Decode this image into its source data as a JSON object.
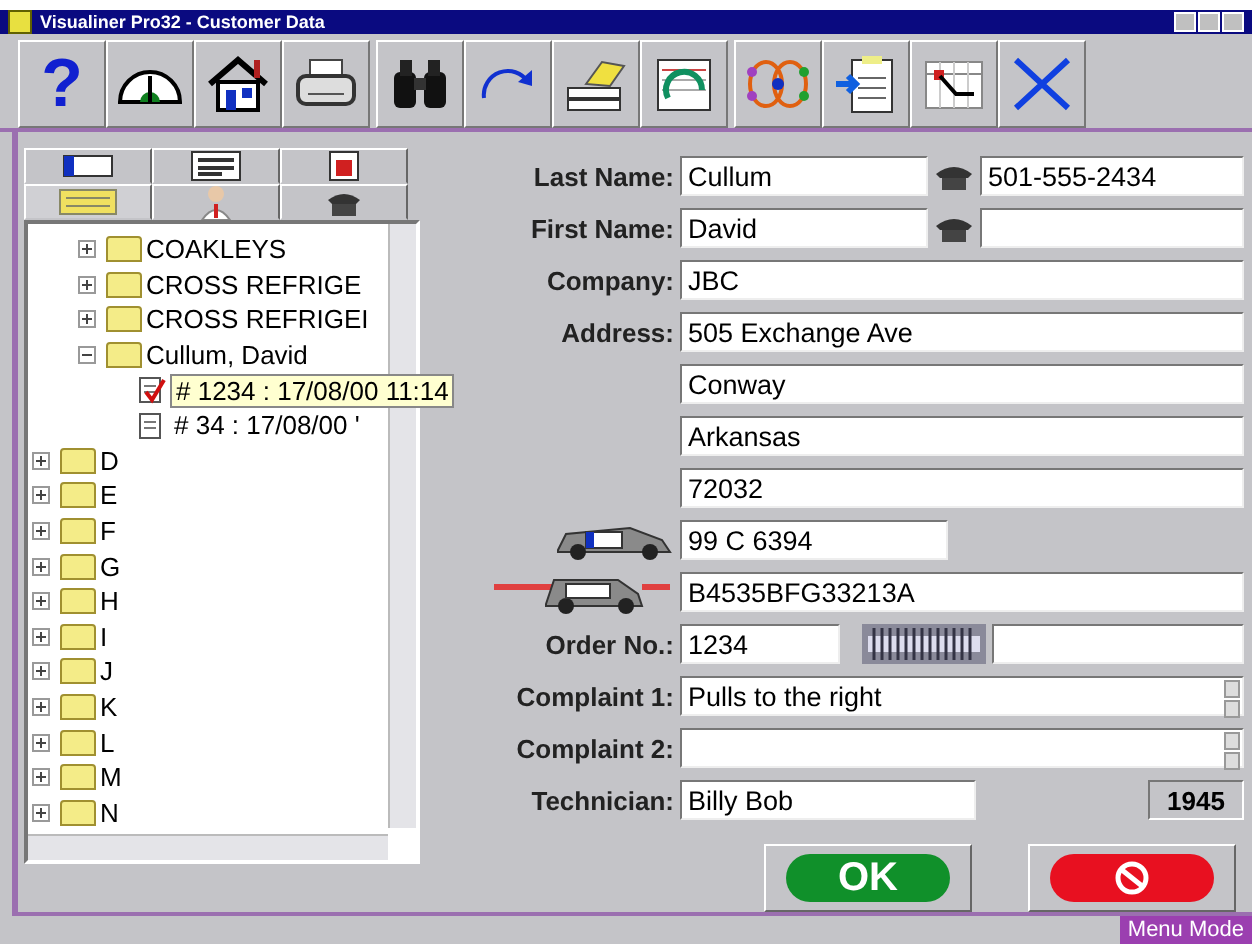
{
  "window": {
    "title": "Visualiner Pro32 - Customer Data"
  },
  "toolbar": [
    [
      {
        "kind": "help",
        "label": "?"
      },
      {
        "kind": "gauge"
      },
      {
        "kind": "home"
      },
      {
        "kind": "printer"
      }
    ],
    [
      {
        "kind": "binoculars"
      },
      {
        "kind": "redo"
      },
      {
        "kind": "eraser"
      },
      {
        "kind": "graph"
      }
    ],
    [
      {
        "kind": "network"
      },
      {
        "kind": "clipboard"
      },
      {
        "kind": "calendar"
      },
      {
        "kind": "close"
      }
    ]
  ],
  "side_tabs": [
    {
      "kind": "plate",
      "selected": false
    },
    {
      "kind": "list",
      "selected": false
    },
    {
      "kind": "calendar",
      "selected": false
    },
    {
      "kind": "card",
      "selected": true
    },
    {
      "kind": "person",
      "selected": false
    },
    {
      "kind": "phone",
      "selected": false
    }
  ],
  "tree": {
    "nodes": [
      {
        "children": [
          {
            "label": "COAKLEYS",
            "expanded": false
          },
          {
            "label": "CROSS  REFRIGE",
            "expanded": false
          },
          {
            "label": "CROSS REFRIGEI",
            "expanded": false
          },
          {
            "label": "Cullum, David",
            "expanded": true,
            "records": [
              {
                "label": "# 1234 : 17/08/00 11:14",
                "checked": true,
                "selected": true
              },
              {
                "label": "# 34 : 17/08/00 '",
                "checked": false,
                "selected": false
              }
            ]
          }
        ]
      },
      {
        "label": "D",
        "expanded": false
      },
      {
        "label": "E",
        "expanded": false
      },
      {
        "label": "F",
        "expanded": false
      },
      {
        "label": "G",
        "expanded": false
      },
      {
        "label": "H",
        "expanded": false
      },
      {
        "label": "I",
        "expanded": false
      },
      {
        "label": "J",
        "expanded": false
      },
      {
        "label": "K",
        "expanded": false
      },
      {
        "label": "L",
        "expanded": false
      },
      {
        "label": "M",
        "expanded": false
      },
      {
        "label": "N",
        "expanded": false
      }
    ]
  },
  "form": {
    "last_name": {
      "label": "Last Name:",
      "value": "Cullum"
    },
    "phone_1": {
      "value": "501-555-2434"
    },
    "first_name": {
      "label": "First Name:",
      "value": "David"
    },
    "company": {
      "label": "Company:",
      "value": "JBC"
    },
    "address": {
      "label": "Address:",
      "lines": [
        "505 Exchange Ave",
        "Conway",
        "Arkansas",
        "72032"
      ]
    },
    "plate": {
      "value": "99 C 6394"
    },
    "vin": {
      "value": "B4535BFG33213A"
    },
    "order_no": {
      "label": "Order No.:",
      "value": "1234"
    },
    "complaint_1": {
      "label": "Complaint 1:",
      "value": "Pulls to the right"
    },
    "complaint_2": {
      "label": "Complaint 2:"
    },
    "technician": {
      "label": "Technician:",
      "value": "Billy Bob",
      "code": "1945"
    }
  },
  "buttons": {
    "ok": "OK"
  },
  "status_bar": {
    "mode": "Menu Mode"
  }
}
